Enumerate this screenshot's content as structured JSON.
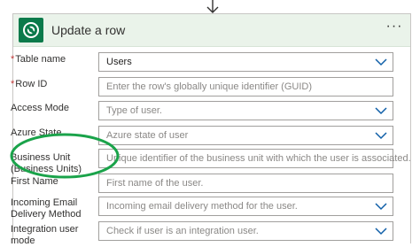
{
  "card": {
    "title": "Update a row",
    "more_label": "···"
  },
  "fields": [
    {
      "label": "Table name",
      "required": true,
      "value": "Users",
      "placeholder": "",
      "dropdown": true
    },
    {
      "label": "Row ID",
      "required": true,
      "value": "",
      "placeholder": "Enter the row's globally unique identifier (GUID)",
      "dropdown": false
    },
    {
      "label": "Access Mode",
      "required": false,
      "value": "",
      "placeholder": "Type of user.",
      "dropdown": true
    },
    {
      "label": "Azure State",
      "required": false,
      "value": "",
      "placeholder": "Azure state of user",
      "dropdown": true
    },
    {
      "label": "Business Unit (Business Units)",
      "required": false,
      "value": "",
      "placeholder": "Unique identifier of the business unit with which the user is associated.",
      "dropdown": false
    },
    {
      "label": "First Name",
      "required": false,
      "value": "",
      "placeholder": "First name of the user.",
      "dropdown": false
    },
    {
      "label": "Incoming Email Delivery Method",
      "required": false,
      "value": "",
      "placeholder": "Incoming email delivery method for the user.",
      "dropdown": true
    },
    {
      "label": "Integration user mode",
      "required": false,
      "value": "",
      "placeholder": "Check if user is an integration user.",
      "dropdown": true
    }
  ],
  "colors": {
    "header_bg": "#eaf3ea",
    "brand_green": "#0b7a4b",
    "highlight_circle": "#1aa34a",
    "required_asterisk": "#c43c3c",
    "chevron": "#0f5fa8"
  }
}
